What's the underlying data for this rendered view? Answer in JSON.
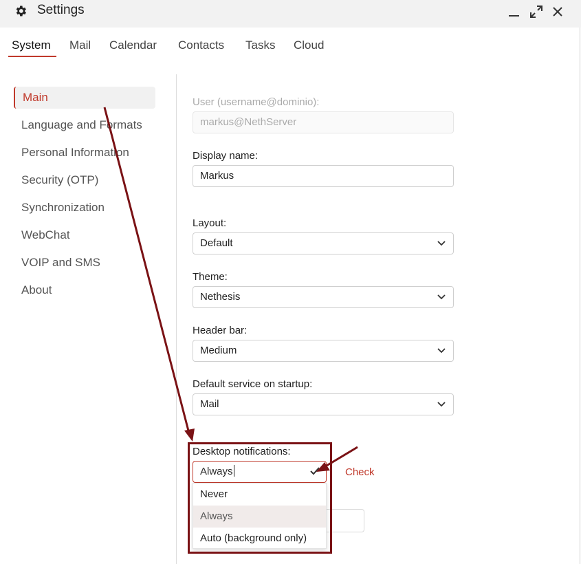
{
  "window": {
    "title": "Settings",
    "icon": "gear-icon"
  },
  "tabs": [
    "System",
    "Mail",
    "Calendar",
    "Contacts",
    "Tasks",
    "Cloud"
  ],
  "sidebar": {
    "items": [
      "Main",
      "Language and Formats",
      "Personal Information",
      "Security (OTP)",
      "Synchronization",
      "WebChat",
      "VOIP and SMS",
      "About"
    ]
  },
  "form": {
    "user_label": "User (username@dominio):",
    "user_value": "markus@NethServer",
    "display_name_label": "Display name:",
    "display_name_value": "Markus",
    "layout_label": "Layout:",
    "layout_value": "Default",
    "theme_label": "Theme:",
    "theme_value": "Nethesis",
    "header_bar_label": "Header bar:",
    "header_bar_value": "Medium",
    "default_service_label": "Default service on startup:",
    "default_service_value": "Mail",
    "desktop_notifications_label": "Desktop notifications:",
    "desktop_notifications_value": "Always",
    "desktop_notifications_options": [
      "Never",
      "Always",
      "Auto (background only)"
    ],
    "check_link": "Check"
  },
  "colors": {
    "accent": "#c0392b",
    "annotation": "#7a1215"
  }
}
